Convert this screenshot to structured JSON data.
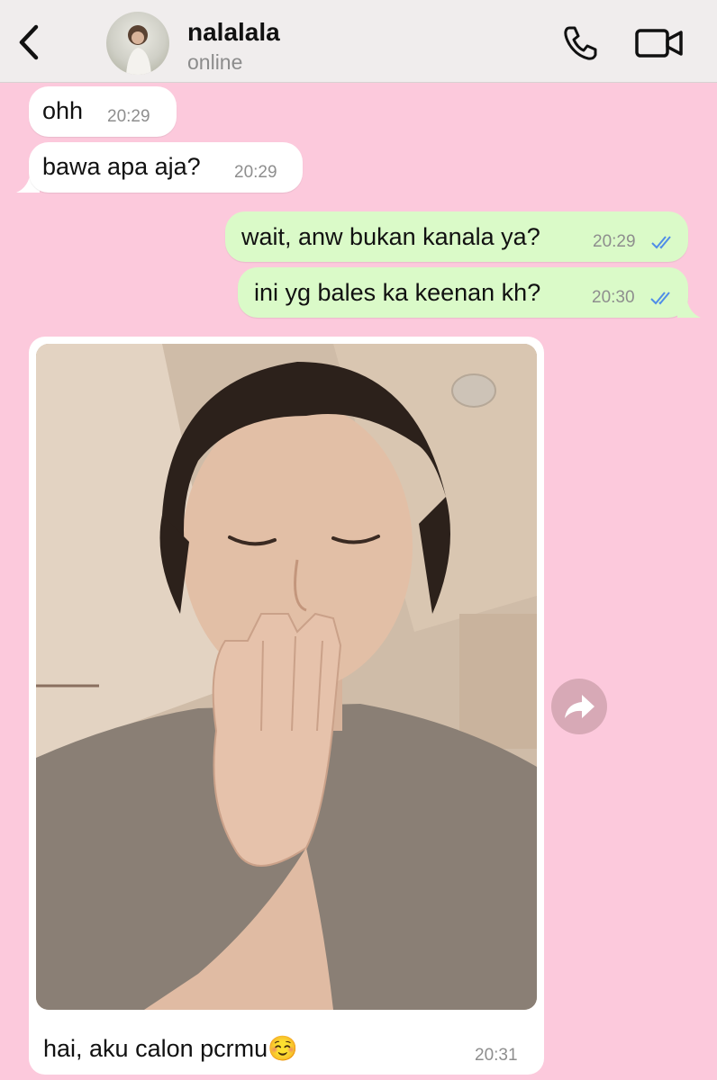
{
  "header": {
    "contact_name": "nalalala",
    "status": "online",
    "back_icon": "chevron-left-icon",
    "call_icon": "phone-icon",
    "video_icon": "video-camera-icon"
  },
  "colors": {
    "chat_background": "#fcc9dc",
    "incoming_bubble": "#ffffff",
    "outgoing_bubble": "#dafac8",
    "read_ticks": "#4f8de8",
    "header_background": "#f0eded"
  },
  "messages": [
    {
      "direction": "incoming",
      "text": "ohh",
      "time": "20:29"
    },
    {
      "direction": "incoming",
      "text": "bawa apa aja?",
      "time": "20:29"
    },
    {
      "direction": "outgoing",
      "text": "wait, anw bukan kanala ya?",
      "time": "20:29",
      "status": "read"
    },
    {
      "direction": "outgoing",
      "text": "ini yg bales ka keenan kh?",
      "time": "20:30",
      "status": "read"
    },
    {
      "direction": "incoming",
      "type": "photo",
      "caption": "hai, aku calon pcrmu☺️",
      "time": "20:31"
    }
  ],
  "forward_icon": "forward-arrow-icon"
}
